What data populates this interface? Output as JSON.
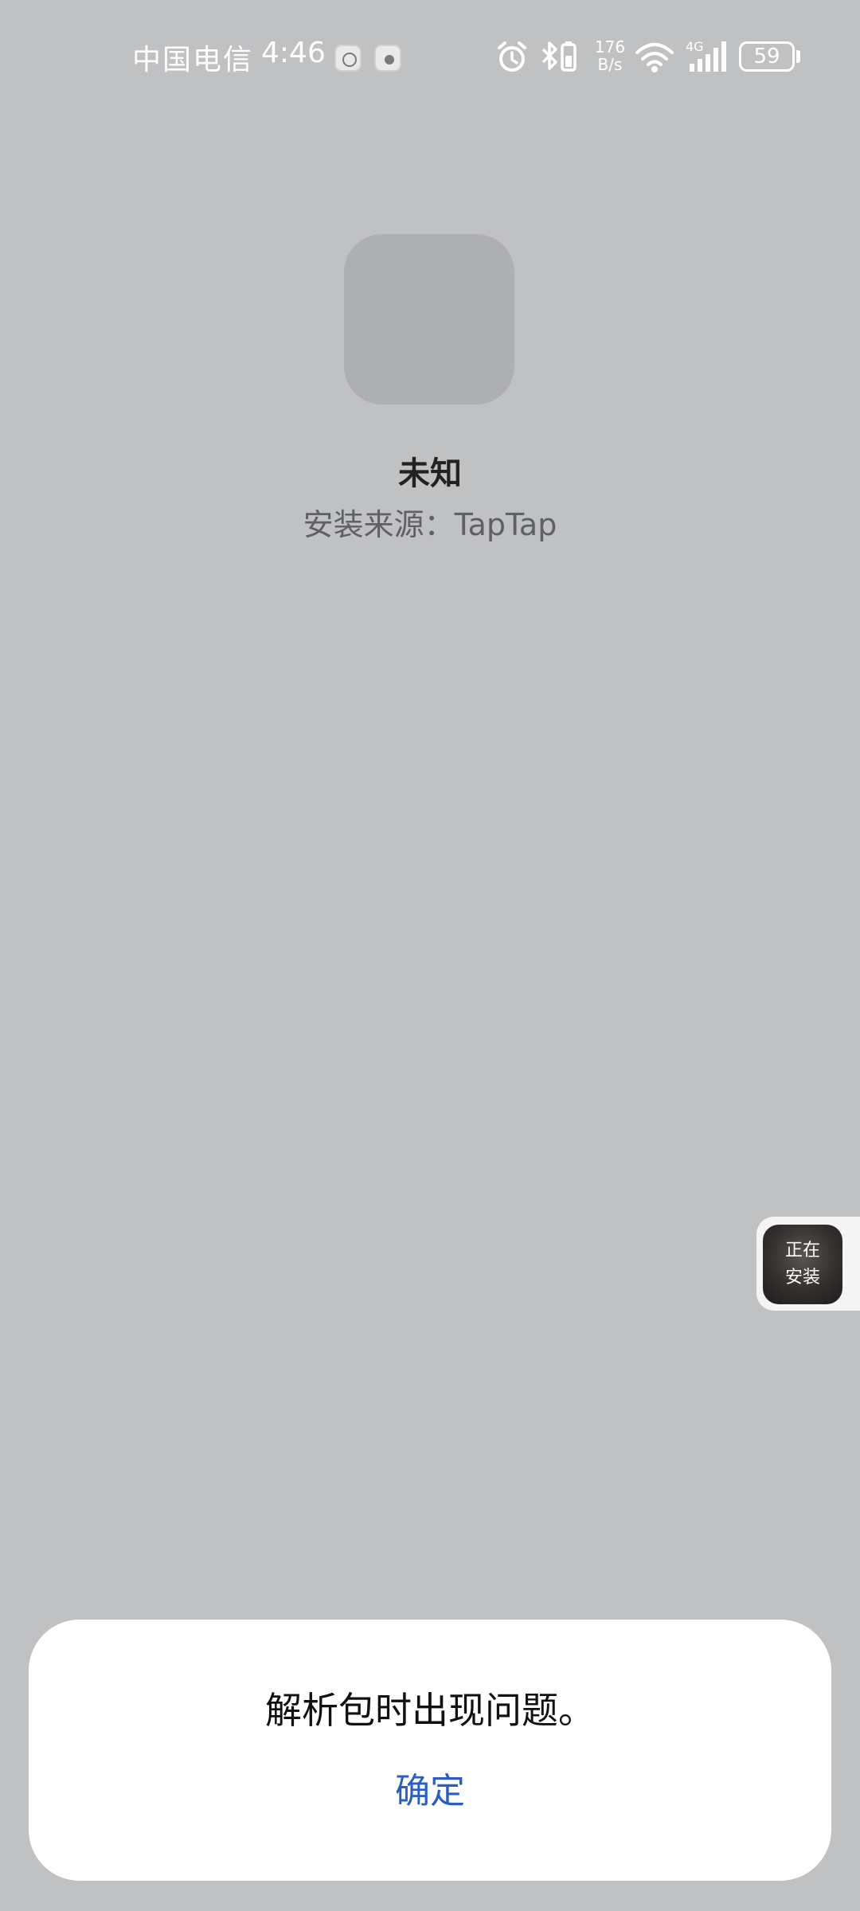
{
  "status_bar": {
    "carrier": "中国电信",
    "time": "4:46",
    "network_speed_value": "176",
    "network_speed_unit": "B/s",
    "network_type": "4G",
    "battery_level": "59",
    "icons": [
      "app-notification-icon",
      "camera-notification-icon",
      "alarm-icon",
      "bluetooth-icon",
      "battery-saver-icon",
      "wifi-icon",
      "cellular-signal-icon",
      "battery-icon"
    ]
  },
  "app": {
    "name": "未知",
    "source": "安装来源：TapTap"
  },
  "floating_installer": {
    "line1": "正在",
    "line2": "安装"
  },
  "dialog": {
    "message": "解析包时出现问题。",
    "confirm_label": "确定"
  },
  "colors": {
    "background": "#c0c1c3",
    "dialog_background": "#ffffff",
    "accent": "#2a5fbf"
  }
}
